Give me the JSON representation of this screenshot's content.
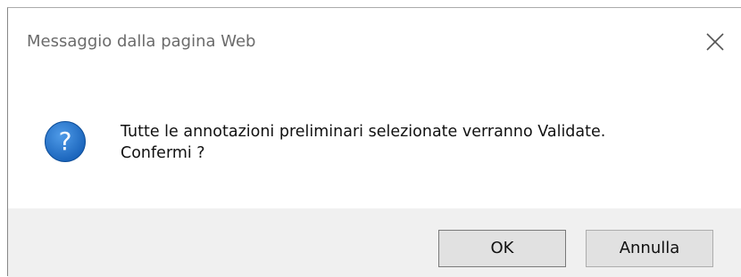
{
  "dialog": {
    "title": "Messaggio dalla pagina Web",
    "close_icon": "close-icon",
    "icon": "question-icon",
    "icon_color": "#1f6fc5",
    "message_line1": "Tutte le annotazioni preliminari selezionate verranno Validate.",
    "message_line2": "Confermi ?",
    "ok_label": "OK",
    "cancel_label": "Annulla"
  }
}
